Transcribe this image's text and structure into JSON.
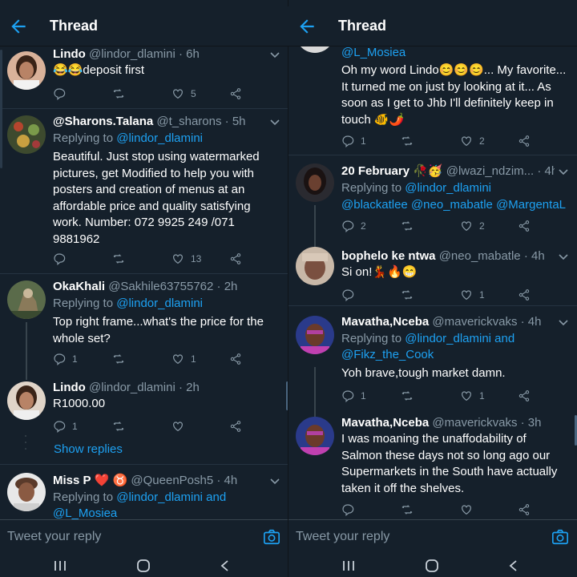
{
  "header_title": "Thread",
  "composer_placeholder": "Tweet your reply",
  "show_replies": "Show replies",
  "colors": {
    "background": "#15202b",
    "accent": "#1da1f2",
    "muted": "#8899a6",
    "divider": "#253341",
    "heart": "#e0245e"
  },
  "left": {
    "tweets": [
      {
        "name": "Lindo",
        "handle": "@lindor_dlamini",
        "time": "· 6h",
        "body_emoji": "😂😂",
        "body_text": "deposit first",
        "likes": "5"
      },
      {
        "name": "@Sharons.Talana",
        "handle": "@t_sharons",
        "time": "· 5h",
        "replying": "Replying to",
        "mention": "@lindor_dlamini",
        "body": "Beautiful. Just stop using watermarked pictures, get Modified to help you with posters and creation of menus at an affordable price and quality satisfying work. Number: 072 9925 249 /071 9881962",
        "likes": "13"
      },
      {
        "name": "OkaKhali",
        "handle": "@Sakhile63755762",
        "time": "· 2h",
        "replying": "Replying to",
        "mention": "@lindor_dlamini",
        "body": "Top right frame...what's the price for the whole set?",
        "replies": "1",
        "likes": "1"
      },
      {
        "name": "Lindo",
        "handle": "@lindor_dlamini",
        "time": "· 2h",
        "body": "R1000.00",
        "replies": "1"
      },
      {
        "name": "Miss P",
        "badges": "❤️ ♉",
        "handle": "@QueenPosh5",
        "time": "· 4h",
        "replying": "Replying to",
        "mention": "@lindor_dlamini",
        "and": "and",
        "mention2": "@L_Mosiea"
      }
    ]
  },
  "right": {
    "tweets": [
      {
        "mention_top": "@L_Mosiea",
        "body_start": "Oh my word Lindo",
        "body_emoji": "😊😊😊",
        "body": "... My favorite... It turned me on just by looking at it... As soon as I get to Jhb I'll definitely keep in touch",
        "body_end_emoji": "🐠🌶️",
        "replies": "1",
        "likes": "2"
      },
      {
        "name": "20 February",
        "badges": "🥀🥳",
        "handle": "@lwazi_ndzim...",
        "time": "· 4h",
        "replying": "Replying to",
        "mention": "@lindor_dlamini",
        "mentions_line": "@blackatlee @neo_mabatle @MargentaL",
        "replies": "2",
        "likes": "2"
      },
      {
        "name": "bophelo ke ntwa",
        "handle": "@neo_mabatle",
        "time": "· 4h",
        "body": "Si on!",
        "body_emoji": "💃🔥😁",
        "likes": "1"
      },
      {
        "name": "Mavatha,Nceba",
        "handle": "@maverickvaks",
        "time": "· 4h",
        "replying": "Replying to",
        "mention": "@lindor_dlamini",
        "and": "and",
        "mention2": "@Fikz_the_Cook",
        "body": "Yoh brave,tough market damn.",
        "replies": "1",
        "likes": "1"
      },
      {
        "name": "Mavatha,Nceba",
        "handle": "@maverickvaks",
        "time": "· 3h",
        "body": "I was moaning the unaffodability of Salmon these days not so long ago our Supermarkets in the South have actually taken it off the shelves."
      }
    ]
  }
}
